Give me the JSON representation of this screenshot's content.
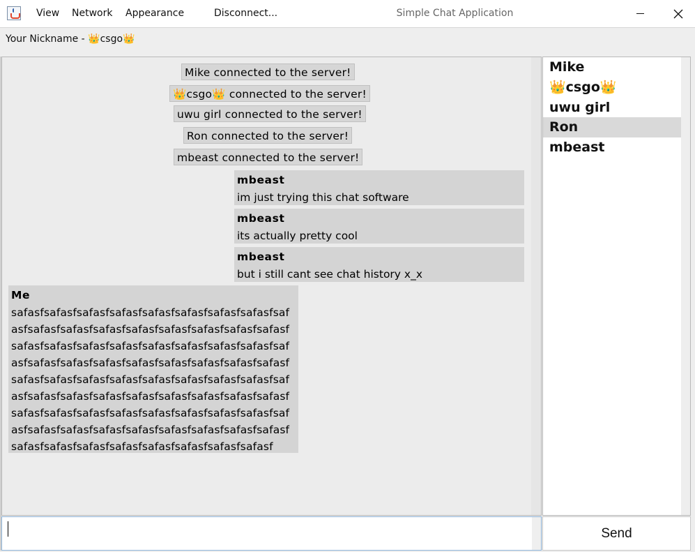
{
  "window": {
    "title": "Simple Chat Application",
    "icon": "java-cup-icon"
  },
  "menu": {
    "items": [
      "View",
      "Network",
      "Appearance",
      "Disconnect..."
    ]
  },
  "nickname": {
    "text": "Your Nickname - 👑csgo👑"
  },
  "chat": {
    "system_messages": [
      "Mike connected to the server!",
      "👑csgo👑 connected to the server!",
      "uwu girl connected to the server!",
      "Ron connected to the server!",
      "mbeast connected to the server!"
    ],
    "messages": [
      {
        "author": "mbeast",
        "text": "im just trying this chat software"
      },
      {
        "author": "mbeast",
        "text": "its actually pretty cool"
      },
      {
        "author": "mbeast",
        "text": "but i still cant see chat history x_x"
      }
    ],
    "own_message": {
      "author": "Me",
      "lines": [
        "safasfsafasfsafasfsafasfsafasfsafasfsafasfsafasfsaf",
        "asfsafasfsafasfsafasfsafasfsafasfsafasfsafasfsafasf",
        "safasfsafasfsafasfsafasfsafasfsafasfsafasfsafasfsaf",
        "asfsafasfsafasfsafasfsafasfsafasfsafasfsafasfsafasf",
        "safasfsafasfsafasfsafasfsafasfsafasfsafasfsafasfsaf",
        "asfsafasfsafasfsafasfsafasfsafasfsafasfsafasfsafasf",
        "safasfsafasfsafasfsafasfsafasfsafasfsafasfsafasfsaf",
        "asfsafasfsafasfsafasfsafasfsafasfsafasfsafasfsafasf",
        "safasfsafasfsafasfsafasfsafasfsafasfsafasfsafasf"
      ]
    }
  },
  "users": {
    "items": [
      "Mike",
      "👑csgo👑",
      "uwu girl",
      "Ron",
      "mbeast"
    ],
    "selected": "Ron"
  },
  "input": {
    "value": "",
    "placeholder": ""
  },
  "send": {
    "label": "Send"
  }
}
